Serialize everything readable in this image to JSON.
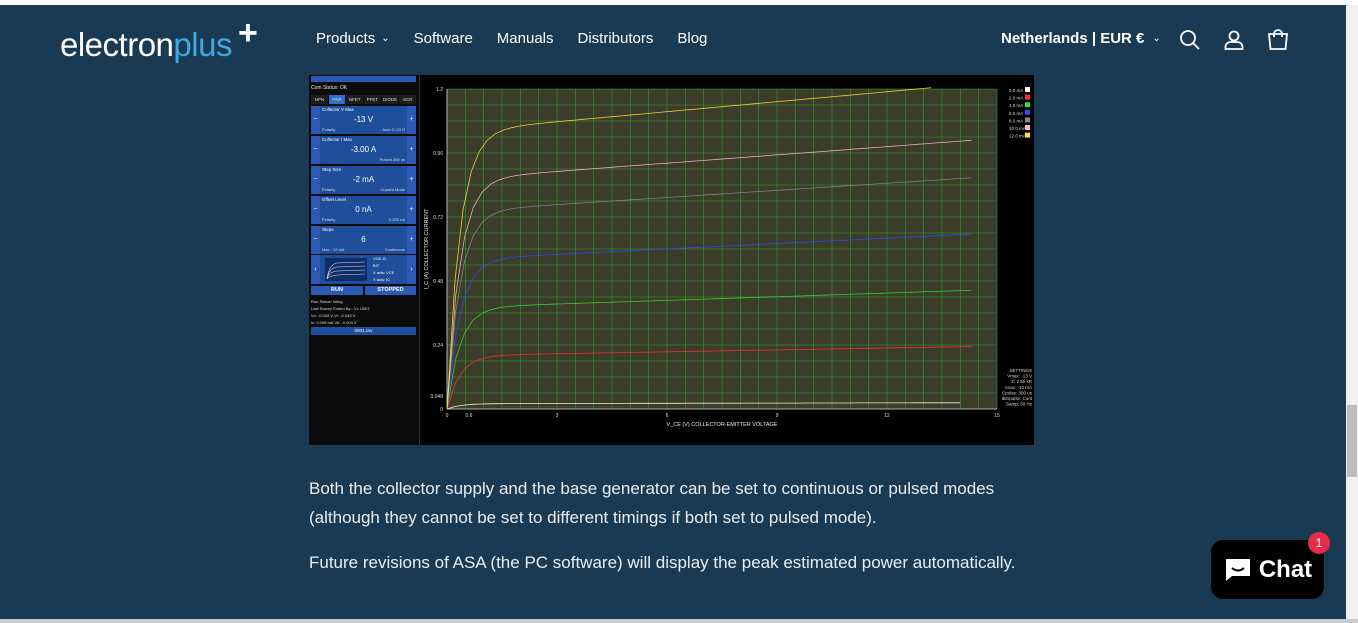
{
  "header": {
    "logo_part1": "electron",
    "logo_part2": "plus",
    "logo_plus": "+",
    "nav": [
      {
        "label": "Products",
        "has_dropdown": true
      },
      {
        "label": "Software"
      },
      {
        "label": "Manuals"
      },
      {
        "label": "Distributors"
      },
      {
        "label": "Blog"
      }
    ],
    "country_selector": "Netherlands | EUR €",
    "icons": [
      "search-icon",
      "account-icon",
      "cart-icon"
    ]
  },
  "screenshot": {
    "side_panel": {
      "com_status": "Com Status: OK",
      "tabs": [
        "NPN",
        "PNP",
        "NFET",
        "PFET",
        "DIODE",
        "SCR"
      ],
      "active_tab": "PNP",
      "controls": [
        {
          "label": "Collector V Max",
          "value": "-13 V",
          "sub_left": "Polarity",
          "sub_right": "Auto Z=24 R"
        },
        {
          "label": "Collector I Max",
          "value": "-3.00 A",
          "sub_left": "",
          "sub_right": "Pulsed 300 us"
        },
        {
          "label": "Step Size",
          "value": "-2 mA",
          "sub_left": "Polarity",
          "sub_right": "Current Mode"
        },
        {
          "label": "Offset Level",
          "value": "0 nA",
          "sub_left": "Polarity",
          "sub_right": "0-200 nA"
        },
        {
          "label": "Steps",
          "value": "6",
          "sub_left": "Max.: 12 mA",
          "sub_right": "Continuous"
        }
      ],
      "mini_labels": [
        "VCE-IC",
        "BIT",
        "X axis: VCE",
        "Y axis: IC"
      ],
      "run_label": "RUN",
      "stop_label": "STOPPED",
      "status_lines": [
        "Run Status: Idling",
        "Last Sweep Ended By:- Vc LIMIT",
        "Vc:    -0.043 V        Vr:    -0.043 V",
        "Ic:    0.008 mA        Vb:    -0.004 V"
      ],
      "file_name": "0001.csv"
    },
    "plot": {
      "y_axis_label": "I_C (A) COLLECTOR CURRENT",
      "x_axis_label": "V_CE (V) COLLECTOR-EMITTER VOLTAGE",
      "y_ticks": [
        "1.2",
        "0.96",
        "0.72",
        "0.48",
        "0.24",
        "0.048",
        "0"
      ],
      "x_ticks": [
        "0",
        "0.6",
        "3",
        "6",
        "9",
        "12",
        "15"
      ],
      "legend": [
        {
          "label": "0.0 mA",
          "color": "#ffffff"
        },
        {
          "label": "2.0 mA",
          "color": "#ff3030"
        },
        {
          "label": "4.0 mA",
          "color": "#33dd33"
        },
        {
          "label": "6.0 mA",
          "color": "#2a4cff"
        },
        {
          "label": "8.0 mA",
          "color": "#888888"
        },
        {
          "label": "10.0 mA",
          "color": "#ffb6c1"
        },
        {
          "label": "12.0 mA",
          "color": "#ffe135"
        }
      ],
      "settings": [
        "SETTINGS",
        "Vmax: -13 V",
        "Z: 2.55 kR",
        "Imax: -10 mA",
        "Cpulse: 300 us",
        "IBGpulse: Cont",
        "Samp: 50 Hz"
      ],
      "curves": [
        {
          "level": 0.02,
          "end_x": 14
        },
        {
          "level": 0.2,
          "end_x": 14.3
        },
        {
          "level": 0.38,
          "end_x": 14.3
        },
        {
          "level": 0.56,
          "end_x": 14.3
        },
        {
          "level": 0.74,
          "end_x": 14.3
        },
        {
          "level": 0.86,
          "end_x": 14.3
        },
        {
          "level": 1.04,
          "end_x": 13.2
        }
      ]
    }
  },
  "content": {
    "paragraph1": "Both the collector supply and the base generator can be set to continuous or pulsed modes (although they cannot be set to different timings if both set to pulsed mode).",
    "paragraph2": "Future revisions of ASA (the PC software) will display the peak estimated power automatically."
  },
  "chat_widget": {
    "label": "Chat",
    "badge_count": "1"
  },
  "colors": {
    "background": "#1a3a54",
    "accent": "#3ea9e0",
    "chat_badge": "#e52d4a"
  }
}
